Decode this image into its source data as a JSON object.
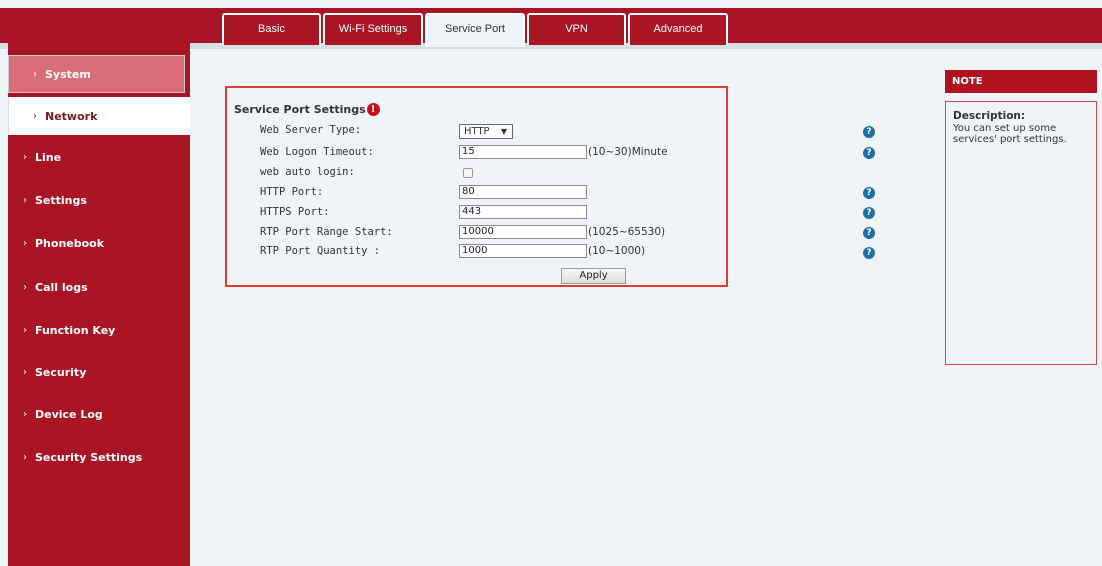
{
  "sidebar": {
    "items": [
      {
        "label": "System"
      },
      {
        "label": "Network"
      },
      {
        "label": "Line"
      },
      {
        "label": "Settings"
      },
      {
        "label": "Phonebook"
      },
      {
        "label": "Call logs"
      },
      {
        "label": "Function Key"
      },
      {
        "label": "Security"
      },
      {
        "label": "Device Log"
      },
      {
        "label": "Security Settings"
      }
    ],
    "active": "Network"
  },
  "tabs": [
    {
      "label": "Basic"
    },
    {
      "label": "Wi-Fi Settings"
    },
    {
      "label": "Service Port"
    },
    {
      "label": "VPN"
    },
    {
      "label": "Advanced"
    }
  ],
  "active_tab": "Service Port",
  "panel": {
    "title": "Service Port Settings",
    "fields": {
      "web_server_type": {
        "label": "Web Server Type:",
        "value": "HTTP"
      },
      "web_logon_timeout": {
        "label": "Web Logon Timeout:",
        "value": "15",
        "unit": "(10~30)Minute"
      },
      "web_auto_login": {
        "label": "web auto login:",
        "checked": false
      },
      "http_port": {
        "label": "HTTP Port:",
        "value": "80"
      },
      "https_port": {
        "label": "HTTPS Port:",
        "value": "443"
      },
      "rtp_port_range_start": {
        "label": "RTP Port Range Start:",
        "value": "10000",
        "unit": "(1025~65530)"
      },
      "rtp_port_quantity": {
        "label": "RTP Port Quantity :",
        "value": "1000",
        "unit": "(10~1000)"
      }
    },
    "apply_label": "Apply"
  },
  "note": {
    "title": "NOTE",
    "description_title": "Description:",
    "description": "You can set up some services' port settings."
  },
  "colors": {
    "brand_red": "#a91525",
    "panel_border": "#e23a2e",
    "help_icon": "#1d6fa5",
    "background": "#eef4f7"
  },
  "icons": {
    "required": "required-icon",
    "help": "help-icon",
    "chevron": "chevron-right-icon"
  }
}
